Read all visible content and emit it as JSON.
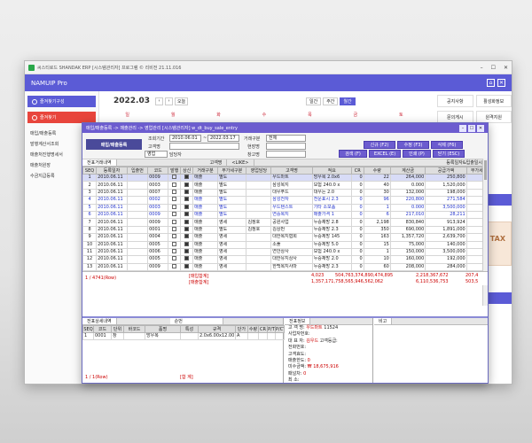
{
  "app": {
    "title": "씨스티로드 SHANDAK ERP [시스템관리자] 프로그램 © 리비전 21.11.016",
    "brand": "NAMUIP Pro"
  },
  "sidebar": {
    "btn1": "즐겨찾기구성",
    "btn2": "즐겨찾기",
    "items": [
      "매입/매출등록",
      "발행계산서조회",
      "매출처진행명세서",
      "매출처원장",
      "수금지급등록"
    ]
  },
  "calendar": {
    "month": "2022.03",
    "prev": "‹",
    "next": "›",
    "today": "오늘",
    "views": [
      "일간",
      "주간",
      "월간"
    ],
    "weekdays": [
      "일",
      "월",
      "화",
      "수",
      "목",
      "금",
      "토"
    ]
  },
  "right_panel": {
    "b1": "공지사항",
    "b2": "활성화정보",
    "b3": "문의게시",
    "b4": "원격지원",
    "month": "22.03",
    "date_rows": [
      "6  7  8  9  10  11  12",
      "13 14 15 16 17 18 19",
      "20 21 22 23 24 25 26",
      "27 28 29 30 31"
    ],
    "schedule_btn": "일정추가",
    "tax": "TAX",
    "text1": "에서 사업자가 가능을",
    "text2": "받는 서비스입니다.",
    "link": "연결하기"
  },
  "dialog": {
    "title": "매입/매출등록 -> 매출관리 -> 영업관리 [시스템관리자] w_dt_buy_sale_entry",
    "mode": "매입/매출등록",
    "lbl_period": "조회기간",
    "date_from": "2010.06.01",
    "date_to": "2022.03.17",
    "lbl_trade": "거래구분",
    "trade": "전체",
    "lbl_client": "고객명",
    "lbl_site": "현장명",
    "lbl_dept": "영업",
    "lbl_staff": "담당자",
    "lbl_wh": "창고명",
    "buttons": [
      "신규 (F2)",
      "수정 (F3)",
      "삭제 (F6)",
      "검색 (F)",
      "EXCEL (E)",
      "인쇄 (P)",
      "닫기 (ESC)"
    ],
    "tab_main": "전표거래내역",
    "tab_client": "고객명",
    "tab_like": "<LIKE>",
    "tab_sort": "등록일자&입출일시"
  },
  "grid": {
    "headers": [
      "SEQ",
      "등록일자",
      "입출번",
      "코드",
      "발행",
      "상신",
      "거래구분",
      "부가세구분",
      "영업담당",
      "고객명",
      "적요",
      "CR",
      "수량",
      "계산금",
      "공급가액",
      "부가세"
    ],
    "rows": [
      [
        "1",
        "2010.06.11",
        "",
        "0009",
        "",
        "1",
        "매출",
        "별도",
        "",
        "우드마트",
        "방우복 2.0x6",
        "0",
        "22",
        "264,000",
        "250,800",
        "1"
      ],
      [
        "2",
        "2010.06.11",
        "",
        "0003",
        "",
        "1",
        "매출",
        "별도",
        "",
        "삼성복지",
        "보험 240.0 x",
        "0",
        "40",
        "0.000",
        "1,520,000",
        "1"
      ],
      [
        "3",
        "2010.06.11",
        "",
        "0007",
        "",
        "1",
        "매출",
        "별도",
        "",
        "대우푸드",
        "대우는 2.0",
        "0",
        "30",
        "132,000",
        "198,000",
        ""
      ],
      [
        "4",
        "2010.06.11",
        "",
        "0002",
        "",
        "1",
        "매출",
        "별도",
        "",
        "삼성전자",
        "전운표시 2.3",
        "0",
        "96",
        "220,800",
        "271,584",
        ""
      ],
      [
        "5",
        "2010.06.11",
        "",
        "0003",
        "",
        "1",
        "매출",
        "별도",
        "",
        "우드텐스트",
        "기타 소모품",
        "0",
        "1",
        "0.000",
        "3,500,000",
        "3"
      ],
      [
        "6",
        "2010.06.11",
        "",
        "0009",
        "",
        "1",
        "매출",
        "별도",
        "",
        "연중복지",
        "매출가격 1",
        "0",
        "6",
        "217,010",
        "28,211",
        ""
      ],
      [
        "7",
        "2010.06.11",
        "",
        "0009",
        "",
        "1",
        "매출",
        "영세",
        "김정호",
        "공원사업",
        "누승채방 2.8",
        "0",
        "2,198",
        "830,840",
        "913,924",
        ""
      ],
      [
        "8",
        "2010.06.11",
        "",
        "0001",
        "",
        "1",
        "매출",
        "별도",
        "김정호",
        "김상번",
        "누승채방 2.3",
        "0",
        "350",
        "690,000",
        "1,891,000",
        ""
      ],
      [
        "9",
        "2010.06.11",
        "",
        "0004",
        "",
        "1",
        "매출",
        "영세",
        "",
        "대한복지협회",
        "누승제방 145",
        "0",
        "163",
        "1,357,720",
        "2,639,700",
        ""
      ],
      [
        "10",
        "2010.06.11",
        "",
        "0005",
        "",
        "1",
        "매출",
        "영세",
        "",
        "소풀",
        "누승제방 5.0",
        "0",
        "15",
        "75,000",
        "140,000",
        ""
      ],
      [
        "11",
        "2010.06.11",
        "",
        "0006",
        "",
        "1",
        "매출",
        "영세",
        "",
        "연안상사",
        "보험 240.0 x",
        "0",
        "1",
        "150,000",
        "3,500,000",
        "3"
      ],
      [
        "12",
        "2010.06.11",
        "",
        "0005",
        "",
        "1",
        "매출",
        "영세",
        "",
        "대한유지상사",
        "누승채방 2.0",
        "0",
        "10",
        "160,000",
        "192,000",
        ""
      ],
      [
        "13",
        "2010.06.11",
        "",
        "0009",
        "",
        "1",
        "매출",
        "영세",
        "",
        "한백복지사마",
        "누승채방 2.3",
        "0",
        "60",
        "208,000",
        "284,000",
        ""
      ]
    ],
    "count": "1 / 4741(Row)",
    "sum1_label": "[매입합계]",
    "sum2_label": "[매출합계]",
    "sum1_vals": [
      "4,023",
      "504,763,374,890,474,895",
      "2,218,367,672",
      "207,4"
    ],
    "sum2_vals": [
      "1,357,171,758,565,946,562,062",
      "6,110,536,753",
      "503,5"
    ]
  },
  "detail": {
    "tab": "전표상세내역",
    "combo": "순번",
    "headers": [
      "SEQ",
      "코드",
      "단위",
      "바코드",
      "품명",
      "특성",
      "규격",
      "단가",
      "수량",
      "CR",
      "P/T",
      "P/CT"
    ],
    "row": [
      "1",
      "0001",
      "창",
      "",
      "방우복",
      "",
      "2.0x6.00x12.00",
      "A",
      "",
      "",
      "",
      ""
    ],
    "foot": "1 / 1(Row)",
    "foot_sum": "[합 계]"
  },
  "info": {
    "tab": "전표정보",
    "lines": [
      [
        "고 객 명:",
        "우드마트",
        "11524"
      ],
      [
        "사업자번호:",
        "",
        ""
      ],
      [
        "대 표 자:",
        "김우드",
        "고객등급:"
      ],
      [
        "전화번호:",
        "",
        ""
      ],
      [
        "고객효도:",
        "",
        ""
      ],
      [
        "매출한도:",
        "0",
        ""
      ],
      [
        "미수금액:",
        "₩ 18,675,916",
        ""
      ],
      [
        "패널차:",
        "0",
        ""
      ],
      [
        "최 소:",
        "",
        ""
      ]
    ],
    "memo_tab": "비고"
  }
}
